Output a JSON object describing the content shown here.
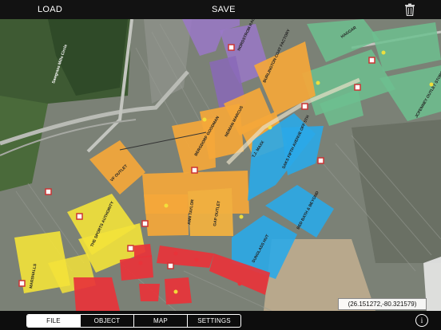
{
  "toolbar": {
    "load_label": "LOAD",
    "save_label": "SAVE",
    "trash_icon": "trash-icon"
  },
  "tabs": [
    {
      "label": "FILE",
      "active": true
    },
    {
      "label": "OBJECT",
      "active": false
    },
    {
      "label": "MAP",
      "active": false
    },
    {
      "label": "SETTINGS",
      "active": false
    }
  ],
  "info_icon": "info-icon",
  "coordinate_readout": "(26.151272,-80.321579)",
  "colors": {
    "orange": "#f4a73a",
    "yellow": "#f3e23a",
    "blue": "#2aa8e8",
    "purple": "#9a78c8",
    "green": "#6dbf8f",
    "red": "#e8333a"
  },
  "store_labels": [
    "VF OUTLET",
    "BURLINGTON COAT FACTORY",
    "BERGDORF GOODMAN",
    "NEIMAN MARCUS",
    "T.J. MAXX",
    "SAKS FIFTH AVENUE OFF 5TH",
    "GAP OUTLET",
    "BED BATH & BEYOND",
    "SUNGLASS HUT",
    "MARSHALLS",
    "THE SPORTS AUTHORITY",
    "JCPENNEY OUTLET STORE",
    "ANN TAYLOR",
    "NORDSTROM RACK",
    "HAGGAR"
  ],
  "road_label": "Sawgrass Mills Circle"
}
